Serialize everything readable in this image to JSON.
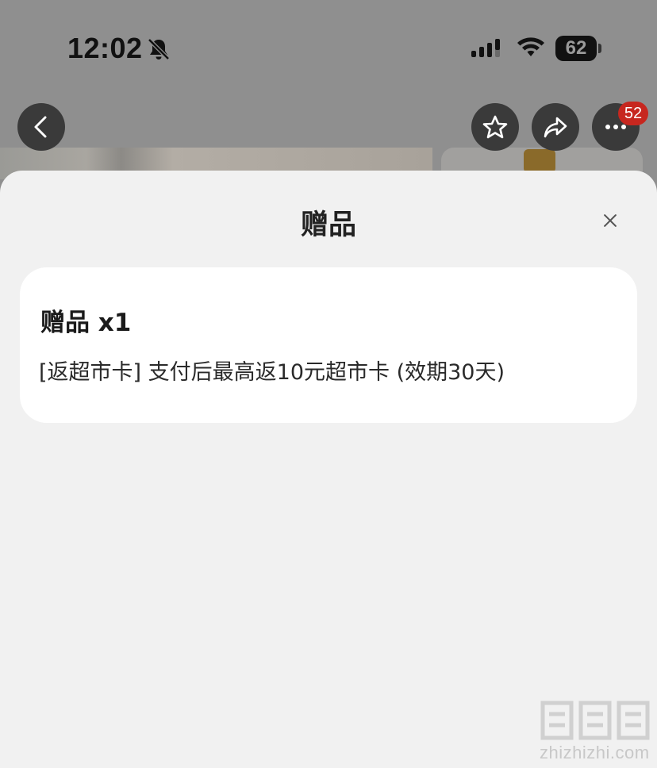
{
  "status_bar": {
    "time": "12:02",
    "battery": "62",
    "icons": [
      "bell-muted-icon",
      "cellular-signal-icon",
      "wifi-icon",
      "battery-icon"
    ]
  },
  "nav": {
    "back_icon": "chevron-left-icon",
    "favorite_icon": "star-icon",
    "share_icon": "share-icon",
    "more_icon": "more-dots-icon",
    "more_badge": "52"
  },
  "sheet": {
    "title": "赠品",
    "close_icon": "close-icon",
    "gift": {
      "title": "赠品 x1",
      "description": "[返超市卡] 支付后最高返10元超市卡 (效期30天)"
    }
  },
  "watermark": {
    "logo": "值值值",
    "text": "zhizhizhi.com"
  },
  "colors": {
    "overlay": "#8f8f8f",
    "sheet_bg": "#f1f1f1",
    "card_bg": "#ffffff",
    "badge_red": "#c7271f",
    "nav_button": "#3a3a3a"
  }
}
